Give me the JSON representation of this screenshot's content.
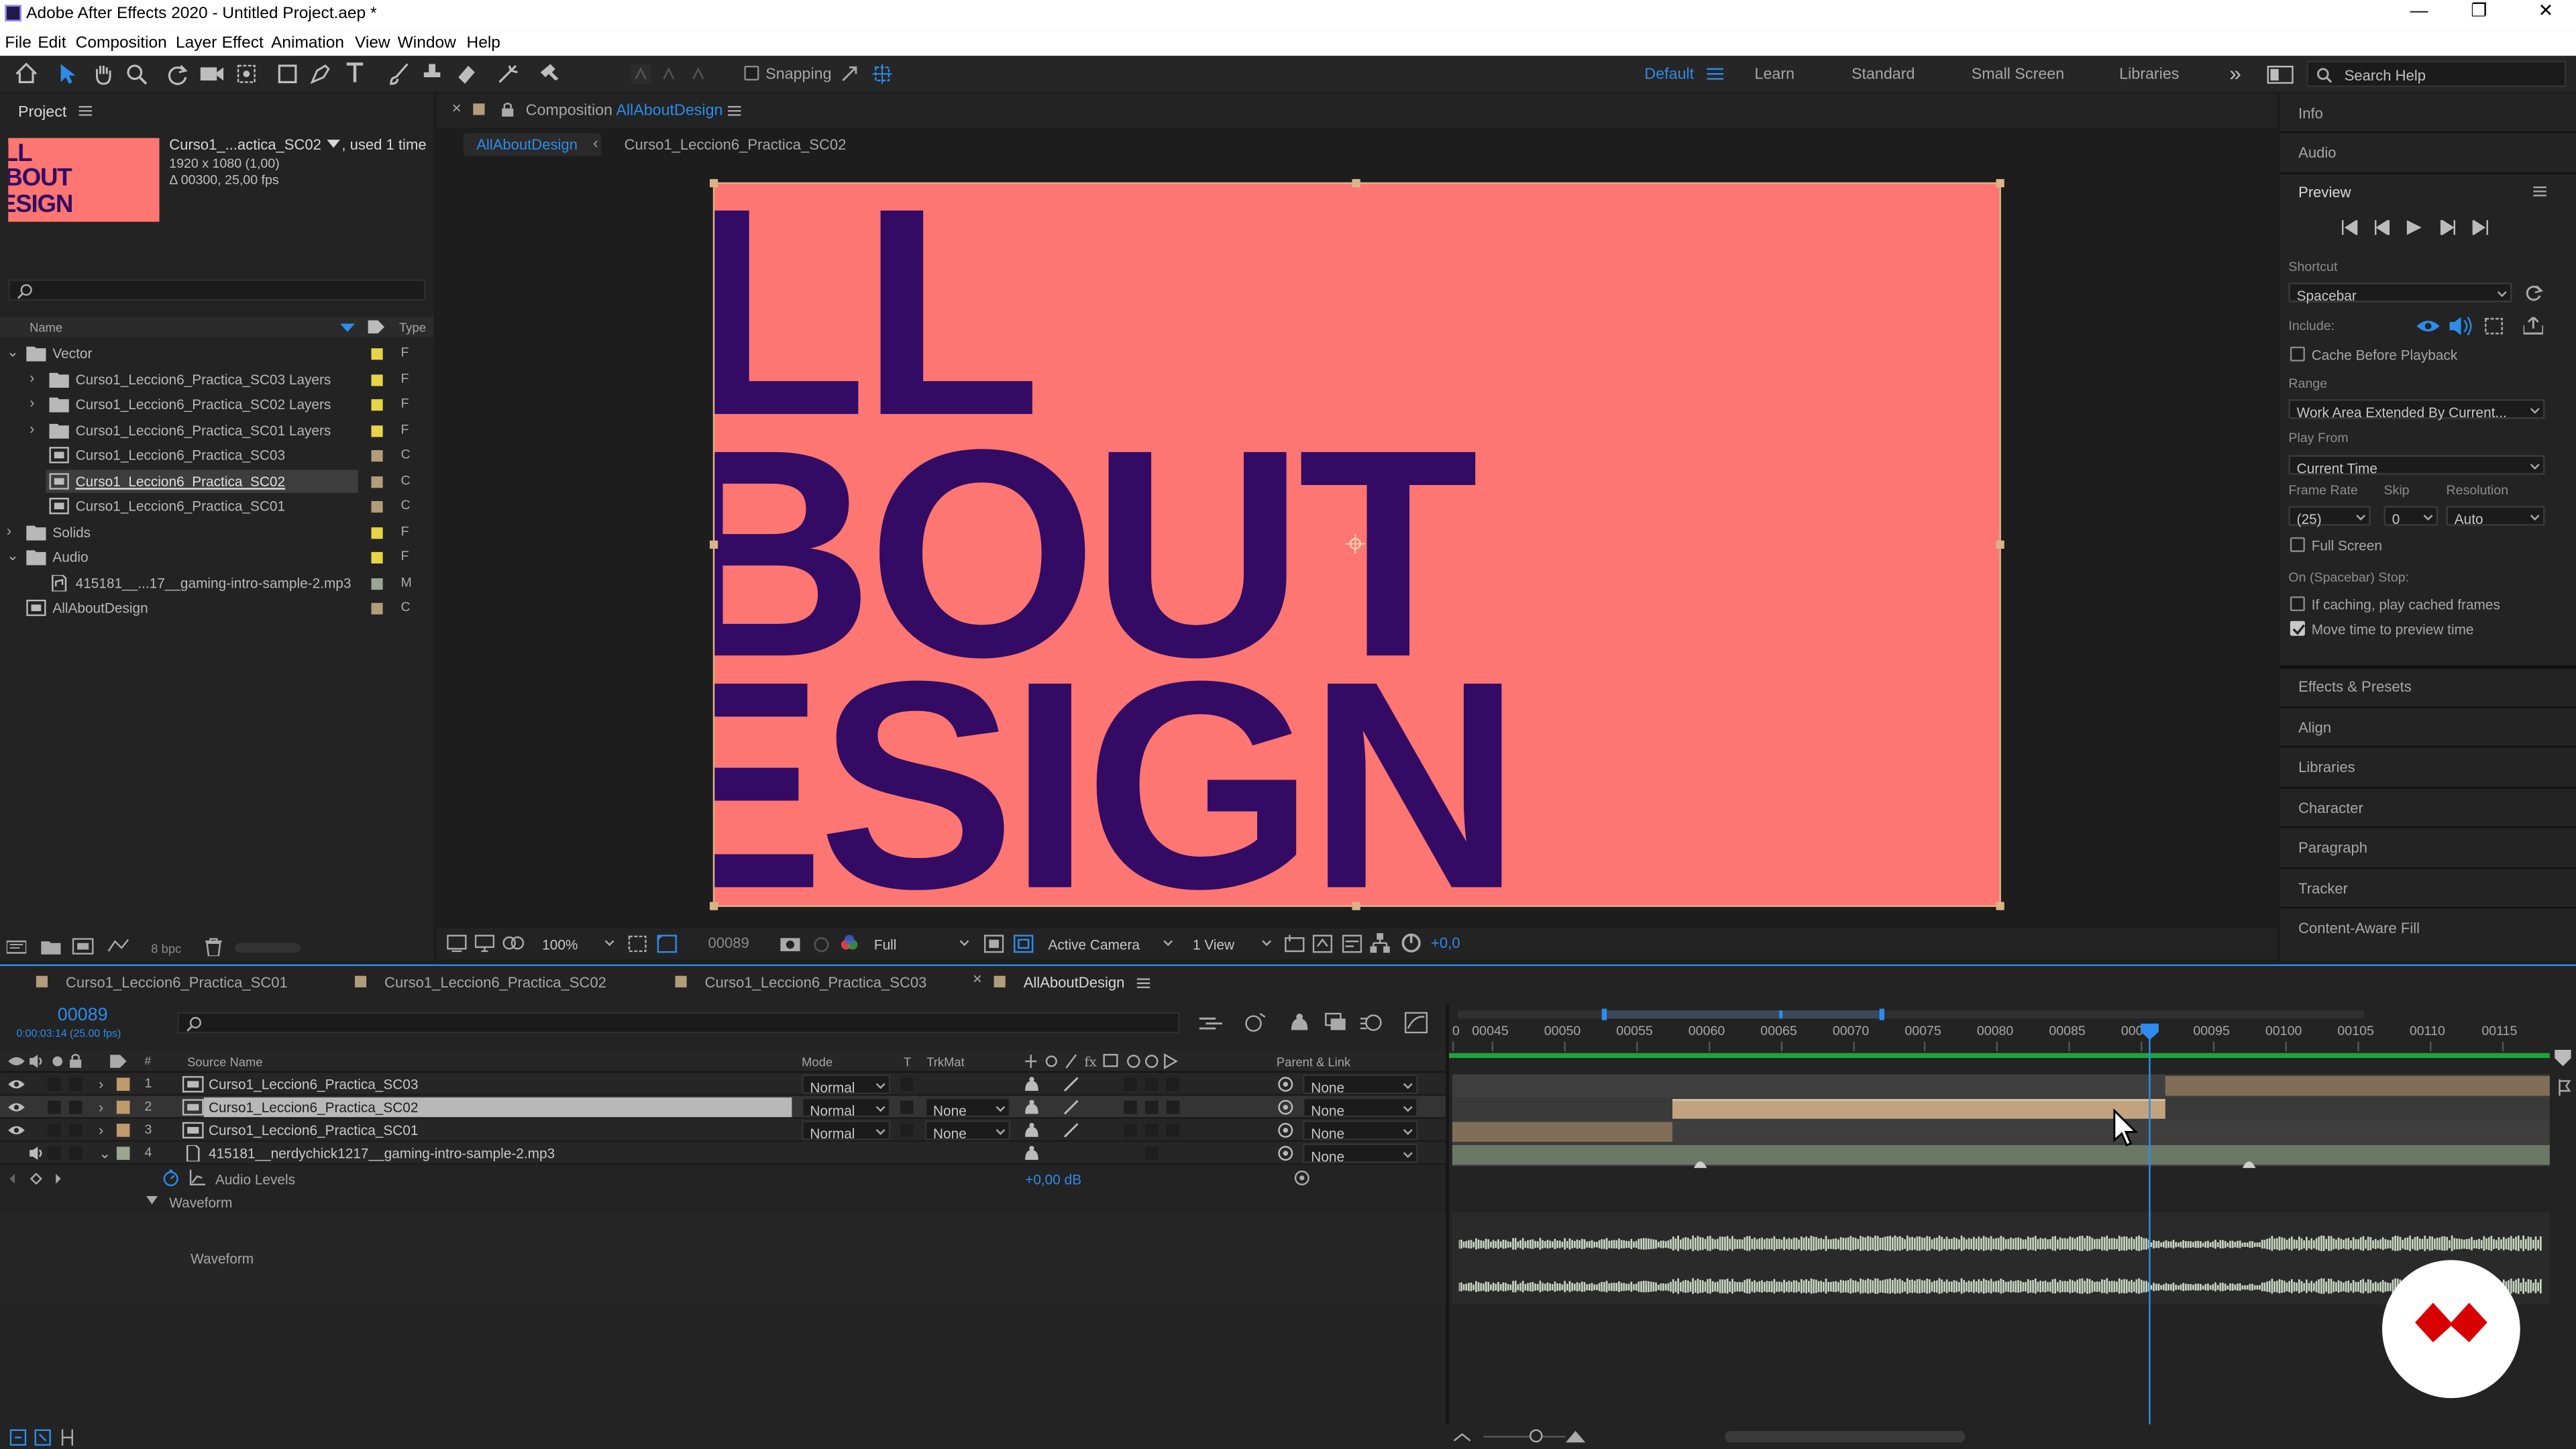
{
  "window": {
    "title": "Adobe After Effects 2020 - Untitled Project.aep *",
    "controls": {
      "minimize": "—",
      "maximize": "❐",
      "close": "✕"
    }
  },
  "menu": [
    "File",
    "Edit",
    "Composition",
    "Layer",
    "Effect",
    "Animation",
    "View",
    "Window",
    "Help"
  ],
  "toolbar": {
    "snapping_label": "Snapping",
    "workspaces": [
      "Default",
      "Learn",
      "Standard",
      "Small Screen",
      "Libraries"
    ],
    "active_workspace": "Default",
    "more": "»",
    "search_placeholder": "Search Help"
  },
  "project": {
    "tab": "Project",
    "selected_name": "Curso1_...actica_SC02",
    "used": ", used 1 time",
    "dimensions": "1920 x 1080 (1,00)",
    "duration": "Δ 00300, 25,00 fps",
    "thumb_lines": [
      "LL",
      "BOUT",
      "ESIGN"
    ],
    "search_icon": "search-icon",
    "col_name": "Name",
    "col_type": "Type",
    "items": [
      {
        "name": "Vector",
        "type": "F",
        "label_color": "#e7d447",
        "kind": "folder",
        "indent": 0,
        "expanded": true
      },
      {
        "name": "Curso1_Leccion6_Practica_SC03 Layers",
        "type": "F",
        "label_color": "#e7d447",
        "kind": "folder",
        "indent": 1,
        "expanded": false
      },
      {
        "name": "Curso1_Leccion6_Practica_SC02 Layers",
        "type": "F",
        "label_color": "#e7d447",
        "kind": "folder",
        "indent": 1,
        "expanded": false
      },
      {
        "name": "Curso1_Leccion6_Practica_SC01 Layers",
        "type": "F",
        "label_color": "#e7d447",
        "kind": "folder",
        "indent": 1,
        "expanded": false
      },
      {
        "name": "Curso1_Leccion6_Practica_SC03",
        "type": "C",
        "label_color": "#b39c79",
        "kind": "comp",
        "indent": 1
      },
      {
        "name": "Curso1_Leccion6_Practica_SC02",
        "type": "C",
        "label_color": "#b39c79",
        "kind": "comp",
        "indent": 1,
        "selected": true
      },
      {
        "name": "Curso1_Leccion6_Practica_SC01",
        "type": "C",
        "label_color": "#b39c79",
        "kind": "comp",
        "indent": 1
      },
      {
        "name": "Solids",
        "type": "F",
        "label_color": "#e7d447",
        "kind": "folder",
        "indent": 0,
        "expanded": false
      },
      {
        "name": "Audio",
        "type": "F",
        "label_color": "#e7d447",
        "kind": "folder",
        "indent": 0,
        "expanded": true
      },
      {
        "name": "415181__...17__gaming-intro-sample-2.mp3",
        "type": "M",
        "label_color": "#9aa690",
        "kind": "file",
        "indent": 1
      },
      {
        "name": "AllAboutDesign",
        "type": "C",
        "label_color": "#b39c79",
        "kind": "comp",
        "indent": 0
      }
    ],
    "bpc": "8 bpc"
  },
  "composition": {
    "tab_prefix": "Composition",
    "tab_name": "AllAboutDesign",
    "breadcrumbs": [
      "AllAboutDesign",
      "Curso1_Leccion6_Practica_SC02"
    ],
    "canvas_bg": "#fd7672",
    "text_color": "#330a64",
    "canvas_lines": [
      "LL",
      "BOUT",
      "ESIGN"
    ],
    "zoom": "100%",
    "timecode": "00089",
    "resolution": "Full",
    "camera": "Active Camera",
    "views": "1 View",
    "exposure": "+0,0"
  },
  "right_panel": {
    "info": "Info",
    "audio": "Audio",
    "preview": "Preview",
    "shortcut_label": "Shortcut",
    "shortcut": "Spacebar",
    "include_label": "Include:",
    "cache_before_playback": "Cache Before Playback",
    "range_label": "Range",
    "range": "Work Area Extended By Current...",
    "play_from_label": "Play From",
    "play_from": "Current Time",
    "frame_rate_label": "Frame Rate",
    "frame_rate": "(25)",
    "skip_label": "Skip",
    "skip": "0",
    "resolution_label": "Resolution",
    "resolution": "Auto",
    "full_screen": "Full Screen",
    "on_stop_label": "On (Spacebar) Stop:",
    "if_caching": "If caching, play cached frames",
    "move_time": "Move time to preview time",
    "collapsed_panels": [
      "Effects & Presets",
      "Align",
      "Libraries",
      "Character",
      "Paragraph",
      "Tracker",
      "Content-Aware Fill"
    ]
  },
  "timeline": {
    "tabs": [
      "Curso1_Leccion6_Practica_SC01",
      "Curso1_Leccion6_Practica_SC02",
      "Curso1_Leccion6_Practica_SC03",
      "AllAboutDesign"
    ],
    "active_tab": "AllAboutDesign",
    "timecode": "00089",
    "timecode_sub": "0:00:03:14 (25.00 fps)",
    "headers": {
      "number": "#",
      "source": "Source Name",
      "mode": "Mode",
      "t": "T",
      "trkmat": "TrkMat",
      "parent": "Parent & Link"
    },
    "layers": [
      {
        "num": "1",
        "name": "Curso1_Leccion6_Practica_SC03",
        "mode": "Normal",
        "trkmat": "",
        "parent": "None",
        "selected": false
      },
      {
        "num": "2",
        "name": "Curso1_Leccion6_Practica_SC02",
        "mode": "Normal",
        "trkmat": "None",
        "parent": "None",
        "selected": true
      },
      {
        "num": "3",
        "name": "Curso1_Leccion6_Practica_SC01",
        "mode": "Normal",
        "trkmat": "None",
        "parent": "None",
        "selected": false
      },
      {
        "num": "4",
        "name": "415181__nerdychick1217__gaming-intro-sample-2.mp3",
        "mode": "",
        "trkmat": "",
        "parent": "None",
        "selected": false
      }
    ],
    "audio_levels_label": "Audio Levels",
    "audio_levels_value": "+0,00 dB",
    "waveform_group": "Waveform",
    "waveform_item": "Waveform",
    "ruler": [
      "0",
      "00045",
      "00050",
      "00055",
      "00060",
      "00065",
      "00070",
      "00075",
      "00080",
      "00085",
      "00090",
      "00095",
      "00100",
      "00105",
      "00110",
      "00115"
    ],
    "current_frame": 89
  }
}
